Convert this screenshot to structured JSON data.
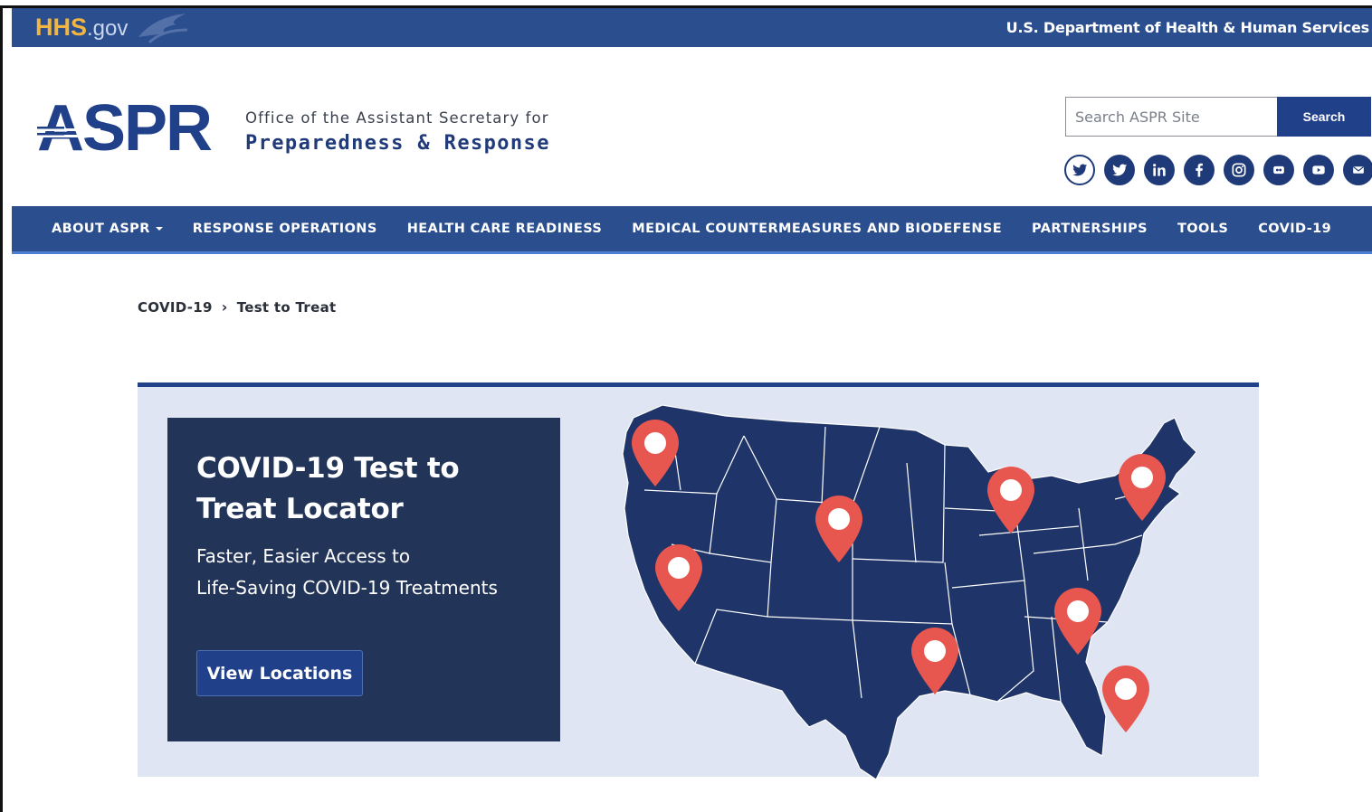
{
  "hhs_bar": {
    "logo_main": "HHS",
    "logo_suffix": ".gov",
    "department": "U.S. Department of Health & Human Services"
  },
  "header": {
    "logo_text": "ASPR",
    "subtitle_line1": "Office of the Assistant Secretary for",
    "subtitle_line2": "Preparedness & Response"
  },
  "search": {
    "placeholder": "Search ASPR Site",
    "button_label": "Search"
  },
  "social_icons": [
    "twitter-outline-icon",
    "twitter-icon",
    "linkedin-icon",
    "facebook-icon",
    "instagram-icon",
    "flickr-icon",
    "youtube-icon",
    "email-icon"
  ],
  "nav": {
    "items": [
      {
        "label": "ABOUT ASPR",
        "has_dropdown": true
      },
      {
        "label": "RESPONSE OPERATIONS"
      },
      {
        "label": "HEALTH CARE READINESS"
      },
      {
        "label": "MEDICAL COUNTERMEASURES AND BIODEFENSE"
      },
      {
        "label": "PARTNERSHIPS"
      },
      {
        "label": "TOOLS"
      },
      {
        "label": "COVID-19"
      }
    ]
  },
  "breadcrumb": {
    "parent": "COVID-19",
    "current": "Test to Treat"
  },
  "hero": {
    "title": "COVID-19 Test to Treat Locator",
    "subtitle_line1": "Faster, Easier Access to",
    "subtitle_line2": "Life-Saving COVID-19 Treatments",
    "button_label": "View Locations"
  },
  "colors": {
    "hhs_bar": "#2b4e8f",
    "accent_yellow": "#f4b63f",
    "brand_navy": "#21408a",
    "card_bg": "#223458",
    "hero_bg": "#dfe5f2",
    "map_fill": "#1f3468",
    "pin_red": "#e8574f"
  }
}
